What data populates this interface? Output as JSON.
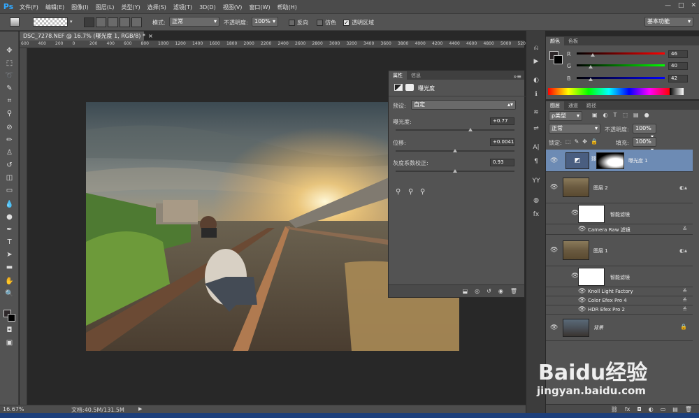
{
  "app": {
    "logo": "Ps"
  },
  "menu": [
    "文件(F)",
    "编辑(E)",
    "图像(I)",
    "图层(L)",
    "类型(Y)",
    "选择(S)",
    "滤镜(T)",
    "3D(D)",
    "视图(V)",
    "窗口(W)",
    "帮助(H)"
  ],
  "window_controls": [
    "—",
    "□",
    "✕"
  ],
  "options": {
    "mode_label": "模式:",
    "mode_value": "正常",
    "opacity_label": "不透明度:",
    "opacity_value": "100%",
    "reverse_label": "反向",
    "dither_label": "仿色",
    "transparency_label": "透明区域",
    "workspace": "基本功能"
  },
  "document": {
    "tab_title": "DSC_7278.NEF @ 16.7% (曝光度 1, RGB/8) *",
    "zoom": "16.67%",
    "doc_size": "文档:40.5M/131.5M"
  },
  "ruler": [
    "600",
    "400",
    "200",
    "0",
    "200",
    "400",
    "600",
    "800",
    "1000",
    "1200",
    "1400",
    "1600",
    "1800",
    "2000",
    "2200",
    "2400",
    "2600",
    "2800",
    "3000",
    "3200",
    "3400",
    "3600",
    "3800",
    "4000",
    "4200",
    "4400",
    "4600",
    "4800",
    "5000",
    "5200"
  ],
  "properties": {
    "tabs": [
      "属性",
      "信息"
    ],
    "title": "曝光度",
    "preset_label": "预设:",
    "preset_value": "自定",
    "exposure_label": "曝光度:",
    "exposure_value": "+0.77",
    "exposure_level": 0.63,
    "offset_label": "位移:",
    "offset_value": "+0.0041",
    "offset_level": 0.5,
    "gamma_label": "灰度系数校正:",
    "gamma_value": "0.93",
    "gamma_level": 0.5
  },
  "color": {
    "tabs": [
      "颜色",
      "色板"
    ],
    "r_label": "R",
    "r_value": "46",
    "g_label": "G",
    "g_value": "40",
    "b_label": "B",
    "b_value": "42",
    "r_level": 0.18,
    "g_level": 0.16,
    "b_level": 0.16
  },
  "layers": {
    "tabs": [
      "图层",
      "通道",
      "路径"
    ],
    "filter_kind": "ρ类型",
    "blend_mode": "正常",
    "opacity_label": "不透明度:",
    "opacity_value": "100%",
    "lock_label": "锁定:",
    "fill_label": "填充:",
    "fill_value": "100%",
    "items": {
      "exposure": "曝光度 1",
      "layer2": "图层 2",
      "smart_filter_a": "智能滤镜",
      "camera_raw": "Camera Raw 滤镜",
      "layer1": "图层 1",
      "smart_filter_b": "智能滤镜",
      "knoll": "Knoll Light Factory",
      "color_efex": "Color Efex Pro 4",
      "hdr_efex": "HDR Efex Pro 2",
      "background": "背景"
    }
  },
  "watermark": {
    "brand": "Baidu经验",
    "url": "jingyan.baidu.com"
  },
  "accent_colors": {
    "highlight": "#6d8bb4",
    "ps_blue": "#31a8ff",
    "taskbar": "#1d3f7a"
  }
}
